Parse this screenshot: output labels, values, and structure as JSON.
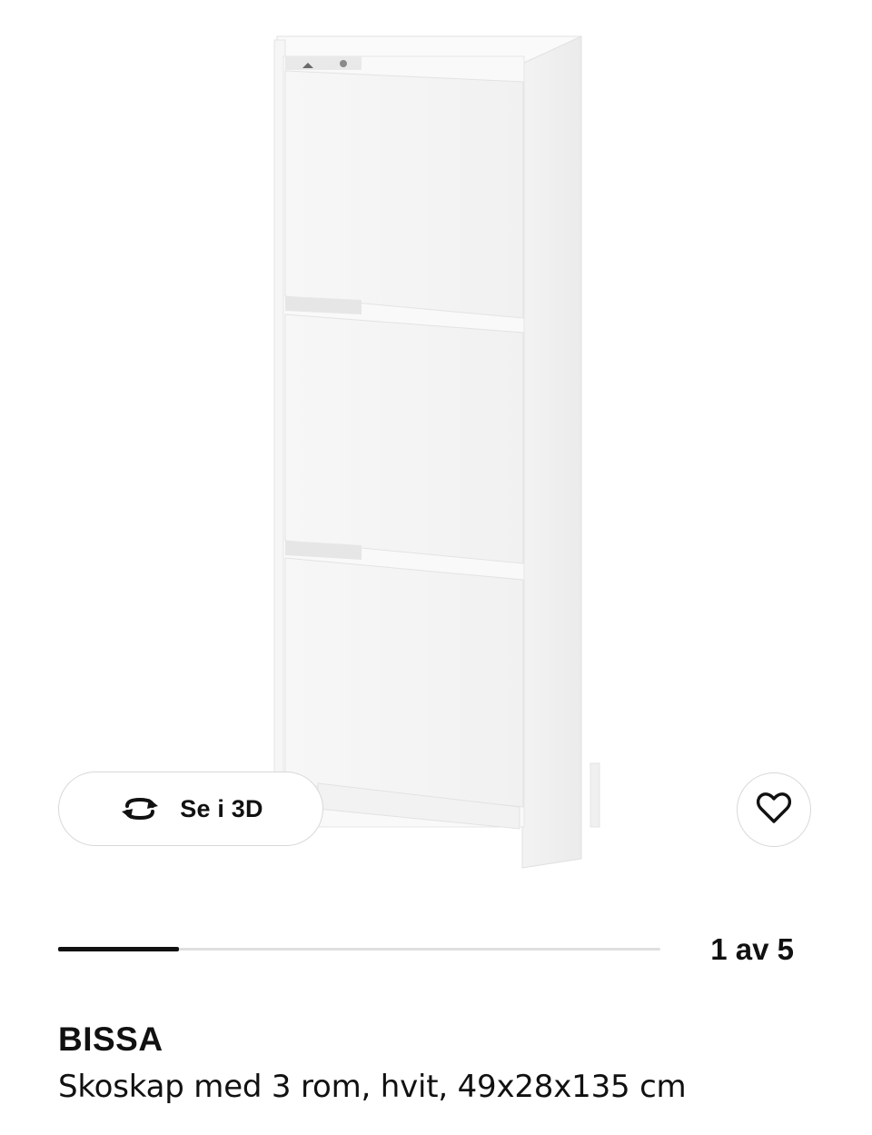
{
  "gallery": {
    "view_3d_label": "Se i 3D",
    "view_3d_icon": "rotate-3d-icon",
    "favourite_icon": "heart-icon",
    "current_image": 1,
    "total_images": 5,
    "counter_text": "1 av 5"
  },
  "product": {
    "name": "BISSA",
    "description": "Skoskap med 3 rom, hvit, 49x28x135 cm"
  },
  "colors": {
    "progress_active": "#111111",
    "progress_track": "#dfdfdf",
    "button_border": "#d8d8d8"
  }
}
